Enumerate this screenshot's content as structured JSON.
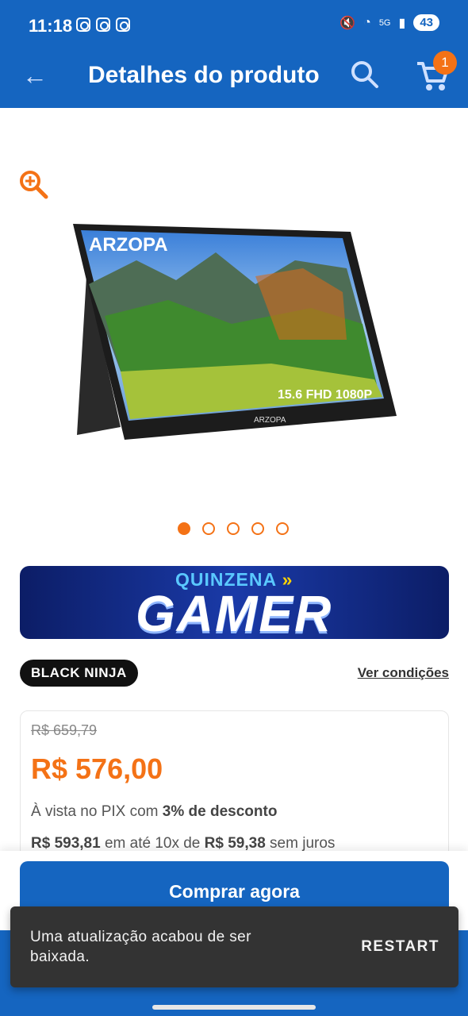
{
  "status": {
    "time": "11:18",
    "battery": "43",
    "network": "5G"
  },
  "header": {
    "title": "Detalhes do produto",
    "cart_count": "1"
  },
  "product": {
    "screen_brand": "ARZOPA",
    "screen_label": "15.6 FHD 1080P",
    "bezel_brand": "ARZOPA",
    "carousel_total": 5,
    "carousel_active": 1
  },
  "banner": {
    "subtitle": "QUINZENA",
    "arrows": "»",
    "title": "GAMER"
  },
  "tag": {
    "label": "BLACK NINJA"
  },
  "conditions_link": "Ver condições",
  "pricing": {
    "old_price": "R$ 659,79",
    "price": "R$ 576,00",
    "pix_prefix": "À vista no PIX com ",
    "pix_discount": "3% de desconto",
    "installment_total": "R$ 593,81",
    "installment_mid": " em até 10x de ",
    "installment_value": "R$ 59,38",
    "installment_suffix": " sem juros"
  },
  "buy_button": "Comprar agora",
  "snackbar": {
    "message": "Uma atualização acabou de ser baixada.",
    "action": "RESTART"
  },
  "colors": {
    "brand_blue": "#1565c0",
    "accent_orange": "#f47216",
    "snackbar_bg": "#333333"
  }
}
